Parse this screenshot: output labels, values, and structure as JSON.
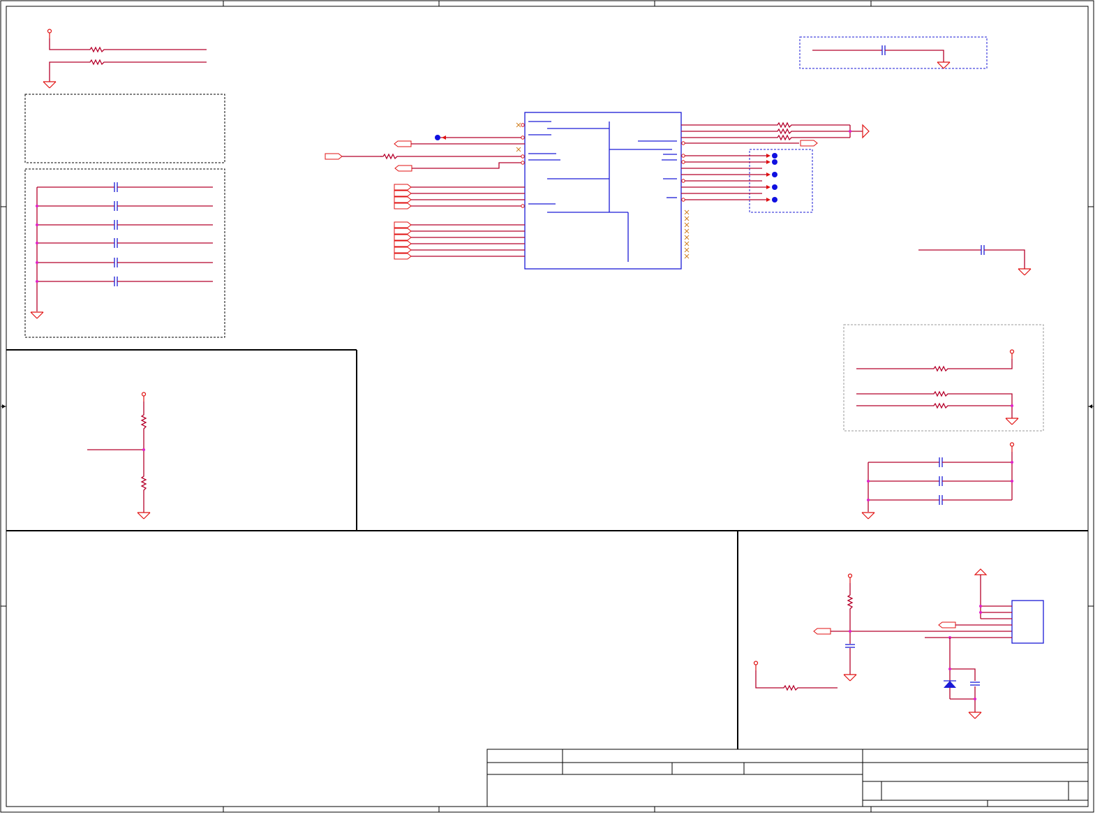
{
  "sheet": {
    "zone_columns": 5,
    "zone_rows": 4
  },
  "title_block": {
    "title": "",
    "company": "",
    "document_number": "",
    "revision": "",
    "date": "",
    "sheet": ""
  },
  "icons": [
    "ground-icon",
    "power-circle-icon",
    "resistor-icon",
    "capacitor-icon",
    "diode-icon",
    "test-point-icon",
    "offpage-connector-icon",
    "no-connect-icon"
  ],
  "colors": {
    "wire": "#b5002a",
    "component": "#1a1ad6",
    "power_symbol": "#e01010",
    "junction": "#e020c8",
    "test_point": "#1010e0",
    "frame": "#000000"
  }
}
